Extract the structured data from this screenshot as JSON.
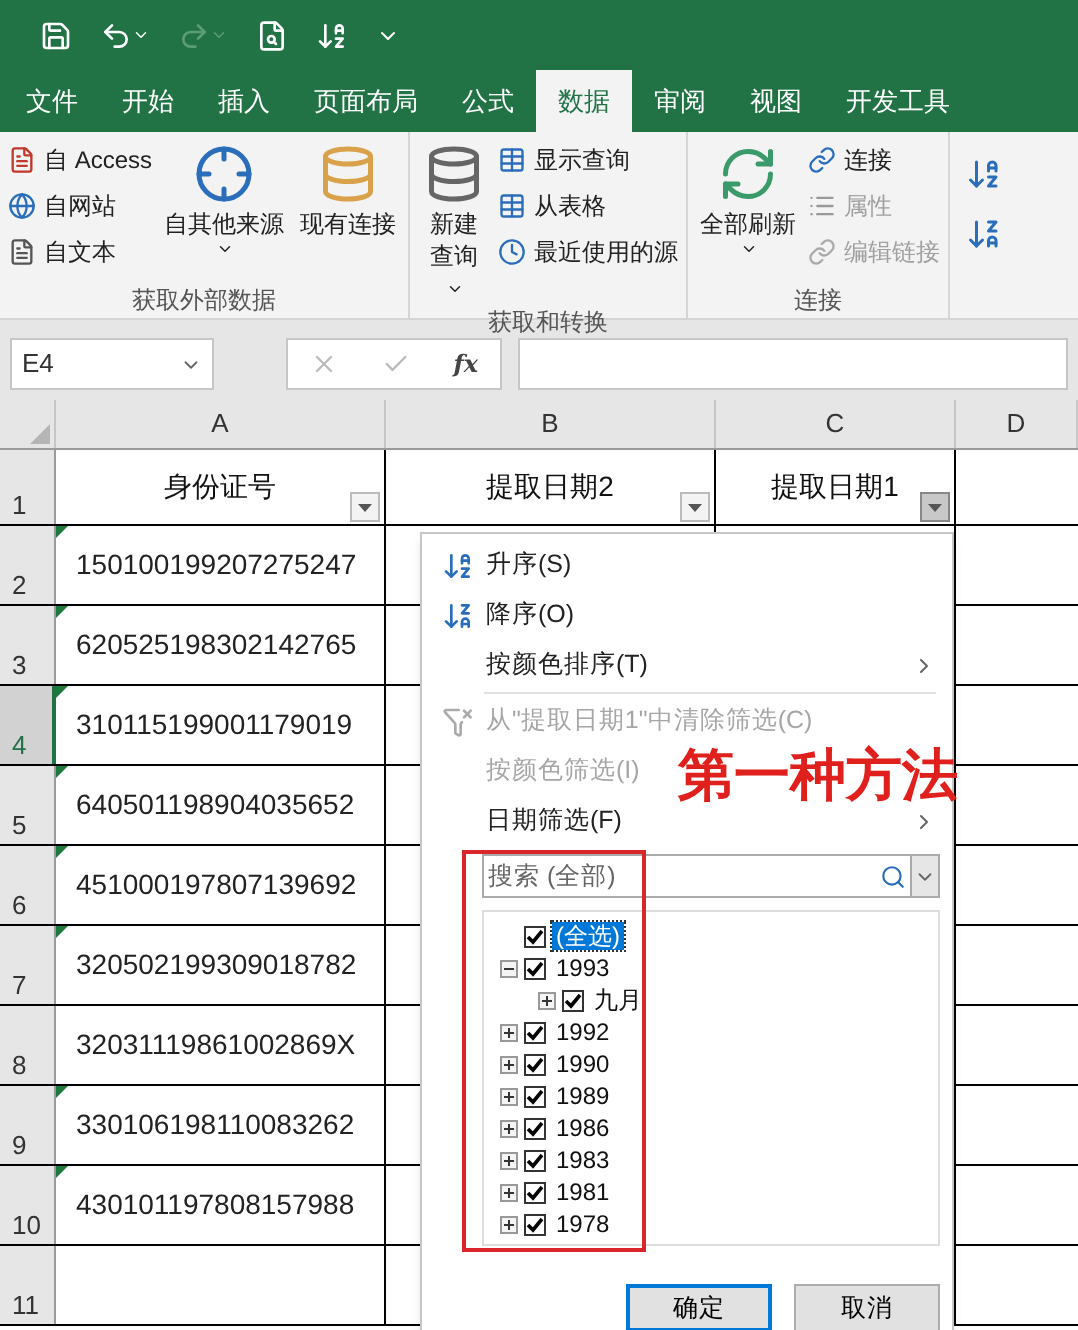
{
  "quick_access": [
    {
      "kind": "save",
      "disabled": false
    },
    {
      "kind": "undo",
      "disabled": false
    },
    {
      "kind": "redo",
      "disabled": true
    },
    {
      "kind": "preview",
      "disabled": false
    },
    {
      "kind": "sort",
      "disabled": false
    },
    {
      "kind": "customize",
      "disabled": false
    }
  ],
  "tabs": [
    {
      "label": "文件",
      "selected": false
    },
    {
      "label": "开始",
      "selected": false
    },
    {
      "label": "插入",
      "selected": false
    },
    {
      "label": "页面布局",
      "selected": false
    },
    {
      "label": "公式",
      "selected": false
    },
    {
      "label": "数据",
      "selected": true
    },
    {
      "label": "审阅",
      "selected": false
    },
    {
      "label": "视图",
      "selected": false
    },
    {
      "label": "开发工具",
      "selected": false
    }
  ],
  "ribbon": {
    "groups": [
      {
        "title": "获取外部数据",
        "items": [
          {
            "kind": "small",
            "label": "自 Access",
            "disabled": false
          },
          {
            "kind": "small",
            "label": "自网站",
            "disabled": false
          },
          {
            "kind": "small",
            "label": "自文本",
            "disabled": false
          },
          {
            "kind": "large",
            "label": "自其他来源",
            "dropdown": true,
            "disabled": false
          },
          {
            "kind": "large",
            "label": "现有连接",
            "dropdown": false,
            "disabled": false
          }
        ]
      },
      {
        "title": "获取和转换",
        "items": [
          {
            "kind": "large",
            "label": "新建查询",
            "dropdown": true,
            "disabled": false
          },
          {
            "kind": "small",
            "label": "显示查询",
            "disabled": false
          },
          {
            "kind": "small",
            "label": "从表格",
            "disabled": false
          },
          {
            "kind": "small",
            "label": "最近使用的源",
            "disabled": false
          }
        ]
      },
      {
        "title": "连接",
        "items": [
          {
            "kind": "large",
            "label": "全部刷新",
            "dropdown": true,
            "disabled": false
          },
          {
            "kind": "small",
            "label": "连接",
            "disabled": false
          },
          {
            "kind": "small",
            "label": "属性",
            "disabled": true
          },
          {
            "kind": "small",
            "label": "编辑链接",
            "disabled": true
          }
        ]
      }
    ]
  },
  "formula_bar": {
    "name_box": "E4",
    "fx_label": "fx"
  },
  "columns": [
    {
      "label": "A",
      "selected": false
    },
    {
      "label": "B",
      "selected": false
    },
    {
      "label": "C",
      "selected": false
    },
    {
      "label": "D",
      "selected": false
    }
  ],
  "header_row": {
    "number": "1",
    "cells": [
      {
        "text": "身份证号",
        "filter_active": false
      },
      {
        "text": "提取日期2",
        "filter_active": false
      },
      {
        "text": "提取日期1",
        "filter_active": true
      }
    ]
  },
  "rows": [
    {
      "number": "2",
      "selected": false,
      "id": "150100199207275247",
      "error_flag": true
    },
    {
      "number": "3",
      "selected": false,
      "id": "620525198302142765",
      "error_flag": true
    },
    {
      "number": "4",
      "selected": true,
      "id": "310115199001179019",
      "error_flag": true
    },
    {
      "number": "5",
      "selected": false,
      "id": "640501198904035652",
      "error_flag": true
    },
    {
      "number": "6",
      "selected": false,
      "id": "451000197807139692",
      "error_flag": true
    },
    {
      "number": "7",
      "selected": false,
      "id": "320502199309018782",
      "error_flag": true
    },
    {
      "number": "8",
      "selected": false,
      "id": "32031119861002869X",
      "error_flag": false
    },
    {
      "number": "9",
      "selected": false,
      "id": "330106198110083262",
      "error_flag": true
    },
    {
      "number": "10",
      "selected": false,
      "id": "430101197808157988",
      "error_flag": true
    },
    {
      "number": "11",
      "selected": false,
      "error_flag": false
    }
  ],
  "filter_menu": {
    "items": [
      {
        "kind": "sort_asc",
        "label": "升序(S)",
        "disabled": false,
        "submenu": false
      },
      {
        "kind": "sort_desc",
        "label": "降序(O)",
        "disabled": false,
        "submenu": false
      },
      {
        "kind": "plain",
        "label": "按颜色排序(T)",
        "disabled": false,
        "submenu": true
      },
      {
        "kind": "separator"
      },
      {
        "kind": "clear",
        "label": "从\"提取日期1\"中清除筛选(C)",
        "disabled": true,
        "submenu": false
      },
      {
        "kind": "plain",
        "label": "按颜色筛选(I)",
        "disabled": true,
        "submenu": false
      },
      {
        "kind": "plain",
        "label": "日期筛选(F)",
        "disabled": false,
        "submenu": true
      }
    ],
    "search": {
      "placeholder": "搜索 (全部)"
    },
    "tree": [
      {
        "label": "(全选)",
        "checked": true,
        "selected": true
      },
      {
        "label": "1993",
        "checked": true,
        "selected": false,
        "expanded": true,
        "children": [
          {
            "label": "九月",
            "checked": true,
            "selected": false,
            "expanded": false
          }
        ]
      },
      {
        "label": "1992",
        "checked": true,
        "selected": false,
        "expanded": false
      },
      {
        "label": "1990",
        "checked": true,
        "selected": false,
        "expanded": false
      },
      {
        "label": "1989",
        "checked": true,
        "selected": false,
        "expanded": false
      },
      {
        "label": "1986",
        "checked": true,
        "selected": false,
        "expanded": false
      },
      {
        "label": "1983",
        "checked": true,
        "selected": false,
        "expanded": false
      },
      {
        "label": "1981",
        "checked": true,
        "selected": false,
        "expanded": false
      },
      {
        "label": "1978",
        "checked": true,
        "selected": false,
        "expanded": false
      }
    ],
    "buttons": [
      {
        "label": "确定",
        "default": true
      },
      {
        "label": "取消",
        "default": false
      }
    ]
  },
  "annotation": {
    "text": "第一种方法"
  }
}
